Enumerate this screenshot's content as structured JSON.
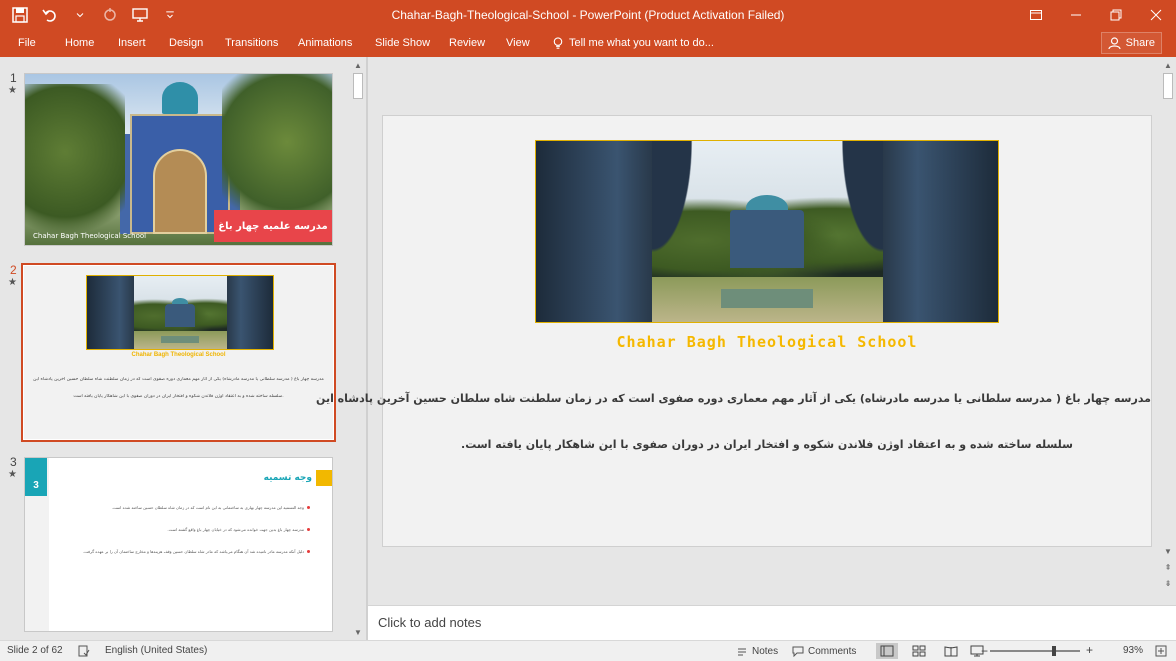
{
  "window": {
    "title": "Chahar-Bagh-Theological-School - PowerPoint (Product Activation Failed)"
  },
  "ribbon": {
    "tabs": [
      "File",
      "Home",
      "Insert",
      "Design",
      "Transitions",
      "Animations",
      "Slide Show",
      "Review",
      "View"
    ],
    "tell_me": "Tell me what you want to do...",
    "share": "Share"
  },
  "thumbnails": {
    "slide1": {
      "number": "1",
      "red_box_text": "مدرسه علمیه چهار باغ",
      "caption": "Chahar Bagh Theological School"
    },
    "slide2": {
      "number": "2",
      "title": "Chahar Bagh Theological School",
      "line1": "مدرسه چهار باغ ( مدرسه سلطانی یا مدرسه مادرشاه) یکی از آثار مهم معماری دوره صفوی است که در زمان سلطنت شاه سلطان حسین آخرین پادشاه این",
      "line2": "سلسله ساخته شده و به اعتقاد اوژن فلاندن شکوه و افتخار ایران در دوران صفوی با این شاهکار پایان یافته است."
    },
    "slide3": {
      "number": "3",
      "badge": "3",
      "heading": "وجه تسمیه",
      "bullets": [
        "وجه التسمیه این مدرسه چهار بهاری به ساختمانی به این نام است که در زمان شاه سلطان حسین ساخته شده است.",
        "مدرسه چهار باغ بدین جهت خوانده می‌شود که در خیابان چهار باغ واقع گشته است.",
        "دلیل آنکه مدرسه مادر نامیده شد آن هنگام می‌باشد که مادر شاه سلطان حسین وقف هزینه‌ها و مخارج ساختمان آن را بر عهده گرفت."
      ]
    },
    "star": "★"
  },
  "slide": {
    "title": "Chahar Bagh Theological School",
    "line1": "مدرسه چهار باغ ( مدرسه سلطانی یا مدرسه مادرشاه) یکی از آثار مهم معماری دوره صفوی است که در زمان سلطنت شاه سلطان حسین آخرین پادشاه این",
    "line2": "سلسله ساخته شده و به اعتقاد اوژن فلاندن شکوه و افتخار ایران در دوران صفوی با این شاهکار پایان یافته است."
  },
  "notes": {
    "placeholder": "Click to add notes"
  },
  "status": {
    "slide_info": "Slide 2 of 62",
    "language": "English (United States)",
    "notes": "Notes",
    "comments": "Comments",
    "zoom": "93%"
  },
  "colors": {
    "accent": "#d04a23",
    "title_yellow": "#f5b800",
    "teal": "#19a5b6"
  }
}
